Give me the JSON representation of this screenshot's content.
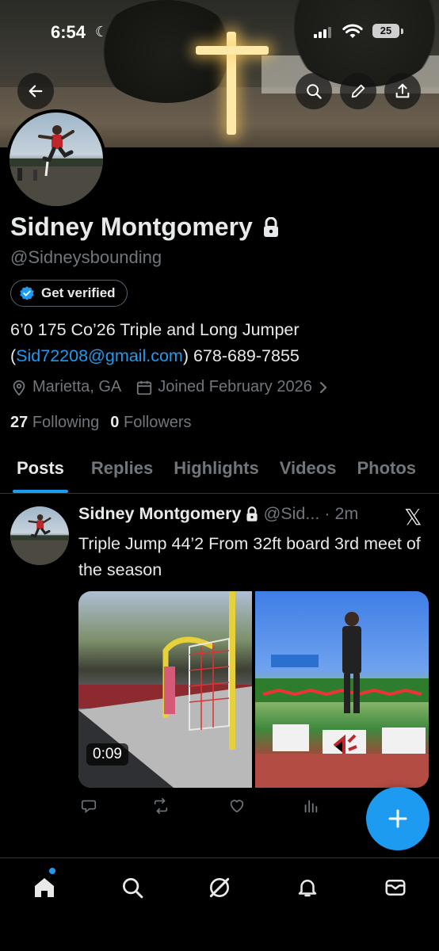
{
  "status_bar": {
    "time": "6:54",
    "battery": "25"
  },
  "profile": {
    "name": "Sidney Montgomery",
    "handle": "@Sidneysbounding",
    "get_verified_label": "Get verified",
    "bio_line1": "6’0 175 Co’26 Triple and Long Jumper",
    "bio_paren_open": "(",
    "bio_email": "Sid72208@gmail.com",
    "bio_after_email": ") 678-689-7855",
    "location": "Marietta, GA",
    "joined": "Joined February 2026",
    "following_count": "27",
    "following_label": "Following",
    "followers_count": "0",
    "followers_label": "Followers"
  },
  "tabs": [
    {
      "label": "Posts",
      "active": true
    },
    {
      "label": "Replies",
      "active": false
    },
    {
      "label": "Highlights",
      "active": false
    },
    {
      "label": "Videos",
      "active": false
    },
    {
      "label": "Photos",
      "active": false
    }
  ],
  "post": {
    "name": "Sidney Montgomery",
    "handle": "@Sid...",
    "separator": "·",
    "time": "2m",
    "text": "Triple Jump 44’2 From 32ft board  3rd meet of the season",
    "video_duration": "0:09"
  },
  "icons": {
    "back": "arrow-left-icon",
    "search": "search-icon",
    "edit": "pencil-icon",
    "share": "share-icon",
    "lock": "lock-icon",
    "verified": "verified-badge-icon",
    "location": "location-pin-icon",
    "calendar": "calendar-icon",
    "chevron": "chevron-right-icon",
    "reply": "reply-icon",
    "repost": "repost-icon",
    "like": "heart-icon",
    "views": "analytics-icon",
    "compose": "plus-icon",
    "nav": [
      "home-icon",
      "search-icon",
      "grok-icon",
      "notifications-icon",
      "messages-icon"
    ]
  },
  "colors": {
    "accent": "#1d9bf0",
    "background": "#000000",
    "text_primary": "#e7e9ea",
    "text_secondary": "#71767b",
    "border": "#2f3336"
  }
}
